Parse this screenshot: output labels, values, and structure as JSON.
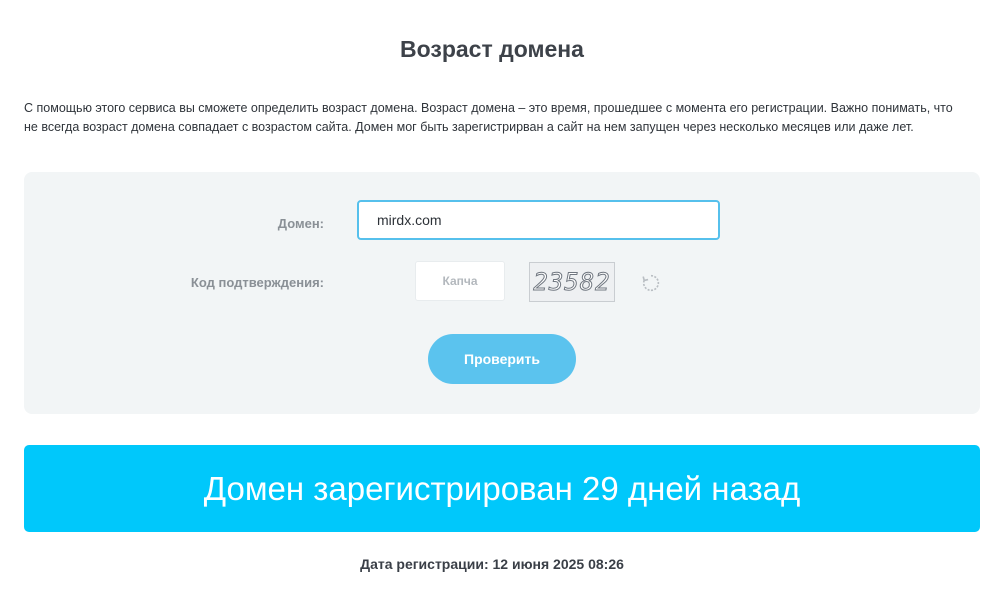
{
  "page": {
    "title": "Возраст домена",
    "intro": "С помощью этого сервиса вы сможете определить возраст домена. Возраст домена – это время, прошедшее с момента его регистрации. Важно понимать, что не всегда возраст домена совпадает с возрастом сайта. Домен мог быть зарегистрирван а сайт на нем запущен через несколько месяцев или даже лет."
  },
  "form": {
    "domain_label": "Домен:",
    "domain_value": "mirdx.com",
    "captcha_label": "Код подтверждения:",
    "captcha_placeholder": "Капча",
    "captcha_image_text": "23582",
    "refresh_icon": "refresh-icon",
    "submit_label": "Проверить"
  },
  "result": {
    "banner_text": "Домен зарегистрирован 29 дней назад",
    "registration_date": "Дата регистрации: 12 июня 2025 08:26"
  },
  "colors": {
    "accent": "#5bc3ee",
    "banner": "#00c8fb",
    "panel": "#f2f5f6"
  }
}
